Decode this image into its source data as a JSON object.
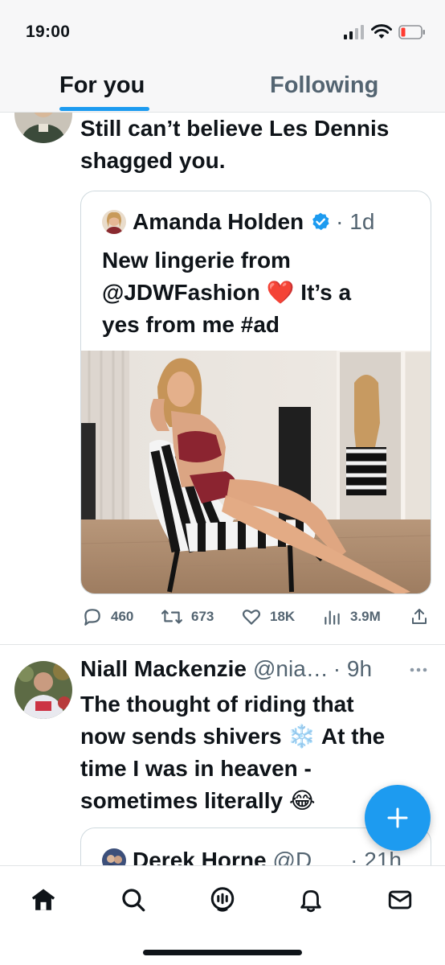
{
  "status_bar": {
    "time": "19:00"
  },
  "tabs": [
    {
      "label": "For you",
      "active": true
    },
    {
      "label": "Following",
      "active": false
    }
  ],
  "tweets": [
    {
      "text_lines": [
        "Still can’t believe Les Dennis",
        "shagged you."
      ],
      "quote": {
        "author": "Amanda Holden",
        "verified": true,
        "age": "· 1d",
        "text_lines": [
          "New lingerie from",
          "@JDWFashion ❤️ It’s a",
          "yes from me #ad"
        ]
      },
      "actions": {
        "replies": "460",
        "retweets": "673",
        "likes": "18K",
        "views": "3.9M"
      }
    },
    {
      "author": "Niall Mackenzie",
      "handle": "@nia…",
      "age": "· 9h",
      "text_lines": [
        "The thought of riding that",
        "now sends shivers ❄️ At the",
        "time I was in heaven -",
        "sometimes literally 😂"
      ],
      "quote": {
        "author": "Derek Horne",
        "handle": "@D…",
        "age": "· 21h"
      }
    }
  ],
  "icons": {
    "reply": "reply-icon",
    "retweet": "retweet-icon",
    "like": "heart-icon",
    "views": "views-icon",
    "share": "share-icon",
    "compose": "plus-icon",
    "nav": [
      "home-icon",
      "search-icon",
      "spaces-icon",
      "bell-icon",
      "mail-icon"
    ]
  },
  "colors": {
    "accent": "#1d9bf0",
    "text": "#0f1419",
    "muted": "#536471"
  }
}
